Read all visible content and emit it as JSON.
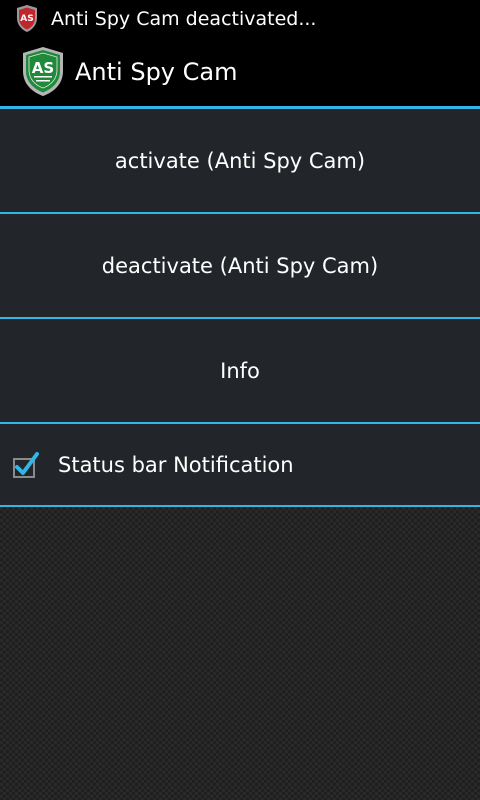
{
  "status_bar": {
    "notification_text": "Anti Spy Cam deactivated...",
    "icon": "anti-spy-cam-red-shield-icon"
  },
  "action_bar": {
    "title": "Anti Spy Cam",
    "logo_text": "AS",
    "logo_icon": "anti-spy-cam-green-shield-logo"
  },
  "menu": {
    "items": [
      {
        "label": "activate (Anti Spy Cam)"
      },
      {
        "label": "deactivate (Anti Spy Cam)"
      },
      {
        "label": "Info"
      }
    ],
    "notification_toggle": {
      "label": "Status bar Notification",
      "checked": true
    }
  },
  "colors": {
    "accent": "#33b5e5",
    "panel": "#22262a",
    "bar": "#000000",
    "logo_green": "#1f8a3a",
    "logo_red": "#c0262c"
  }
}
